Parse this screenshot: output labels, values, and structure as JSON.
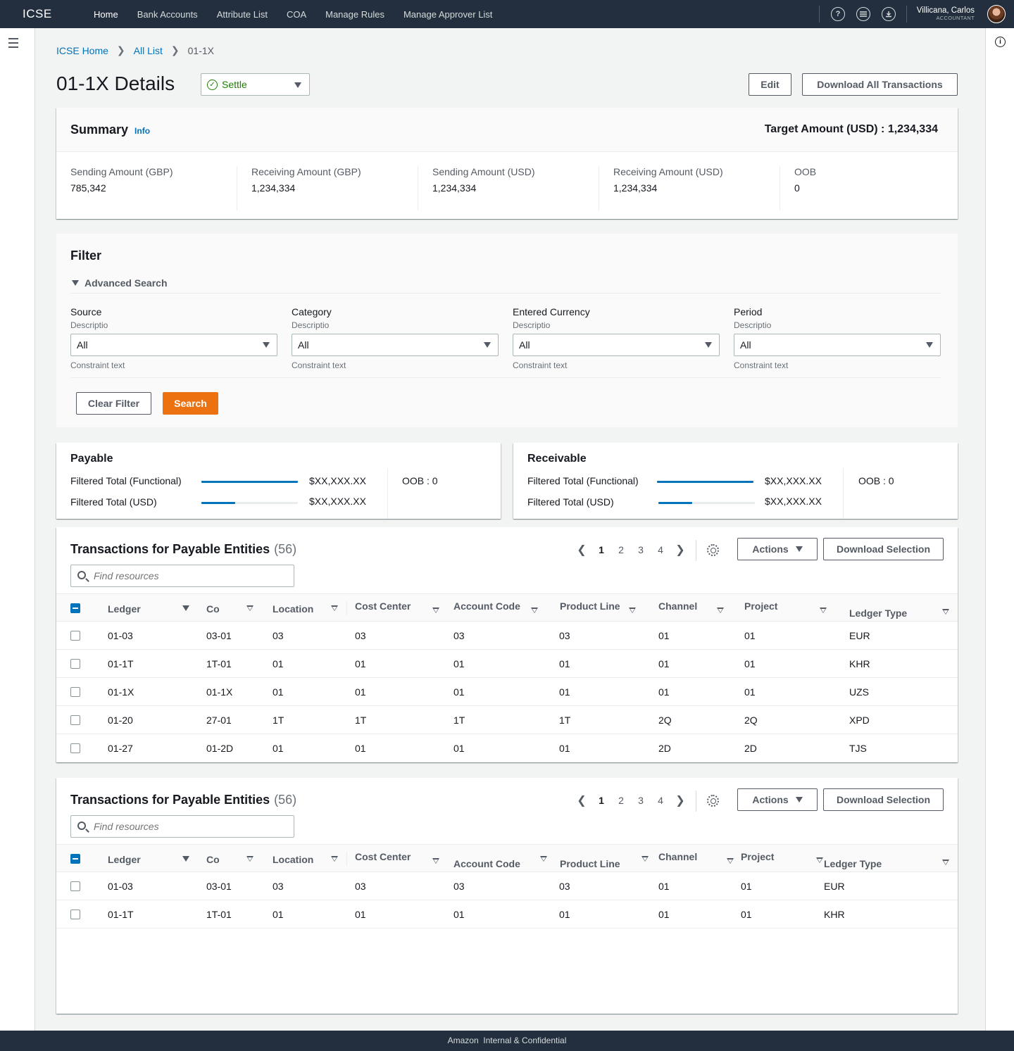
{
  "nav": {
    "brand": "ICSE",
    "links": [
      "Home",
      "Bank Accounts",
      "Attribute List",
      "COA",
      "Manage Rules",
      "Manage Approver List"
    ],
    "user_name": "Villicana, Carlos",
    "user_role": "ACCOUNTANT"
  },
  "breadcrumb": [
    "ICSE Home",
    "All List",
    "01-1X"
  ],
  "page": {
    "title": "01-1X Details",
    "status": "Settle",
    "edit_label": "Edit",
    "download_all_label": "Download All Transactions"
  },
  "summary": {
    "title": "Summary",
    "info": "Info",
    "target": "Target Amount (USD) : 1,234,334",
    "items": [
      {
        "label": "Sending Amount (GBP)",
        "value": "785,342"
      },
      {
        "label": "Receiving Amount (GBP)",
        "value": "1,234,334"
      },
      {
        "label": "Sending Amount (USD)",
        "value": "1,234,334"
      },
      {
        "label": "Receiving Amount (USD)",
        "value": "1,234,334"
      },
      {
        "label": "OOB",
        "value": "0"
      }
    ]
  },
  "filter": {
    "title": "Filter",
    "advanced": "Advanced Search",
    "fields": [
      {
        "label": "Source",
        "desc": "Descriptio",
        "value": "All",
        "constraint": "Constraint text"
      },
      {
        "label": "Category",
        "desc": "Descriptio",
        "value": "All",
        "constraint": "Constraint text"
      },
      {
        "label": "Entered Currency",
        "desc": "Descriptio",
        "value": "All",
        "constraint": "Constraint text"
      },
      {
        "label": "Period",
        "desc": "Descriptio",
        "value": "All",
        "constraint": "Constraint text"
      }
    ],
    "clear_label": "Clear Filter",
    "search_label": "Search"
  },
  "payable": {
    "title": "Payable",
    "rows": [
      {
        "label": "Filtered Total (Functional)",
        "amount": "$XX,XXX.XX",
        "fill": 1.0
      },
      {
        "label": "Filtered Total (USD)",
        "amount": "$XX,XXX.XX",
        "fill": 0.35
      }
    ],
    "oob": "OOB : 0"
  },
  "receivable": {
    "title": "Receivable",
    "rows": [
      {
        "label": "Filtered Total (Functional)",
        "amount": "$XX,XXX.XX",
        "fill": 1.0
      },
      {
        "label": "Filtered Total (USD)",
        "amount": "$XX,XXX.XX",
        "fill": 0.35
      }
    ],
    "oob": "OOB : 0"
  },
  "tables": [
    {
      "title": "Transactions for Payable Entities",
      "count": "(56)",
      "search_placeholder": "Find resources",
      "pages": [
        "1",
        "2",
        "3",
        "4"
      ],
      "actions_label": "Actions",
      "download_label": "Download Selection",
      "columns": [
        "Ledger",
        "Co",
        "Location",
        "Cost Center",
        "Account Code",
        "Product Line",
        "Channel",
        "Project",
        "Ledger Type"
      ],
      "rows": [
        [
          "01-03",
          "03-01",
          "03",
          "03",
          "03",
          "03",
          "01",
          "01",
          "EUR"
        ],
        [
          "01-1T",
          "1T-01",
          "01",
          "01",
          "01",
          "01",
          "01",
          "01",
          "KHR"
        ],
        [
          "01-1X",
          "01-1X",
          "01",
          "01",
          "01",
          "01",
          "01",
          "01",
          "UZS"
        ],
        [
          "01-20",
          "27-01",
          "1T",
          "1T",
          "1T",
          "1T",
          "2Q",
          "2Q",
          "XPD"
        ],
        [
          "01-27",
          "01-2D",
          "01",
          "01",
          "01",
          "01",
          "2D",
          "2D",
          "TJS"
        ]
      ]
    },
    {
      "title": "Transactions for Payable Entities",
      "count": "(56)",
      "search_placeholder": "Find resources",
      "pages": [
        "1",
        "2",
        "3",
        "4"
      ],
      "actions_label": "Actions",
      "download_label": "Download Selection",
      "columns": [
        "Ledger",
        "Co",
        "Location",
        "Cost Center",
        "Account Code",
        "Product Line",
        "Channel",
        "Project",
        "Ledger Type"
      ],
      "rows": [
        [
          "01-03",
          "03-01",
          "03",
          "03",
          "03",
          "03",
          "01",
          "01",
          "EUR"
        ],
        [
          "01-1T",
          "1T-01",
          "01",
          "01",
          "01",
          "01",
          "01",
          "01",
          "KHR"
        ]
      ]
    }
  ],
  "footer": "Amazon  Internal & Confidential",
  "colors": {
    "nav_bg": "#232f3e",
    "link": "#0073bb",
    "primary": "#ec7211",
    "success": "#1d8102"
  }
}
